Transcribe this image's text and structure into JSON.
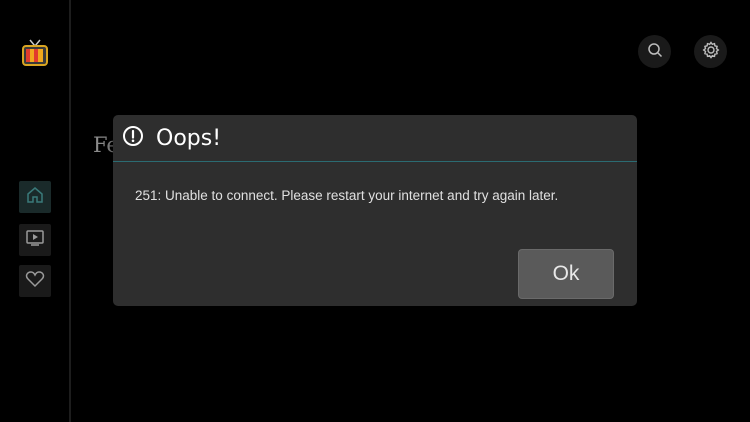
{
  "background": {
    "partial_title": "Fe"
  },
  "sidebar": {
    "items": [
      {
        "icon": "home-icon",
        "active": true
      },
      {
        "icon": "play-icon",
        "active": false
      },
      {
        "icon": "heart-icon",
        "active": false
      }
    ]
  },
  "header": {
    "search_icon": "search-icon",
    "settings_icon": "gear-icon"
  },
  "dialog": {
    "title": "Oops!",
    "message": "251: Unable to connect. Please restart your internet and try again later.",
    "ok_label": "Ok",
    "accent_color": "#2b6b72"
  }
}
